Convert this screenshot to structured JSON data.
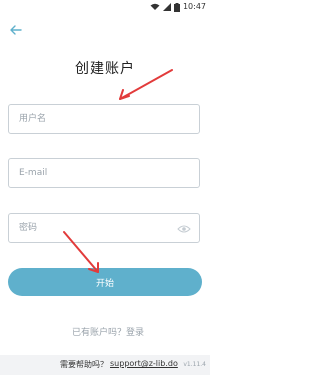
{
  "status_bar": {
    "time": "10:47",
    "icons": [
      "wifi-icon",
      "signal-icon",
      "battery-icon"
    ]
  },
  "header": {
    "back_icon": "arrow-left-icon",
    "title": "创建账户"
  },
  "form": {
    "username": {
      "value": "",
      "placeholder": "用户名"
    },
    "email": {
      "value": "",
      "placeholder": "E-mail"
    },
    "password": {
      "value": "",
      "placeholder": "密码",
      "icon": "eye-icon"
    }
  },
  "actions": {
    "start_label": "开始",
    "start_color": "#5fb0cc"
  },
  "footer": {
    "login_prompt": "已有账户吗？登录",
    "help_prefix": "需要帮助吗？",
    "help_link": "support@z-lib.do",
    "version": "v1.11.4"
  },
  "annotations": {
    "arrow_color": "#e23b3b"
  }
}
